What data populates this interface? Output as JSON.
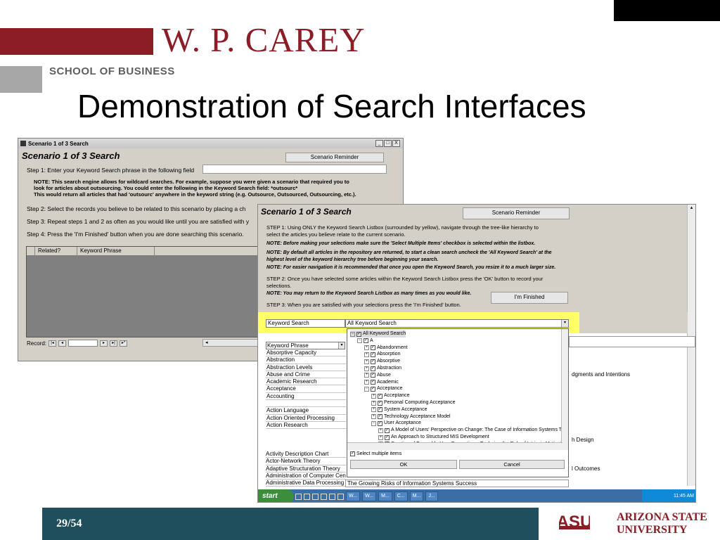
{
  "slide": {
    "brand_title": "W. P. CAREY",
    "school": "SCHOOL OF BUSINESS",
    "title": "Demonstration of Search Interfaces",
    "page": "29/54",
    "logo_text": "ASU",
    "university_line1": "ARIZONA STATE",
    "university_line2": "UNIVERSITY",
    "colors": {
      "brand_red": "#8c1d26",
      "footer": "#1f4f5c"
    }
  },
  "window1": {
    "titlebar": "Scenario 1 of 3 Search",
    "controls": [
      "_",
      "□",
      "X"
    ],
    "heading": "Scenario 1 of 3 Search",
    "reminder_button": "Scenario Reminder",
    "step1": "Step 1: Enter your Keyword Search phrase in the following field",
    "note_line1": "NOTE:  This search engine allows for wildcard searches.  For example, suppose you were given a scenario that required you to",
    "note_line2": "look for articles about outsourcing.   You could enter the following in the Keyword Search field:   *outsourc*",
    "note_line3": "This would return  all articles that had 'outsourc' anywhere in the keyword string (e.g. Outsource, Outsourced, Outsourcing, etc.).",
    "step2": "Step 2: Select the records you believe to be related to this scenario by placing a ch",
    "step3": "Step 3: Repeat steps 1 and 2 as often as you would like until you are satisfied with y",
    "step4": "Step 4: Press the 'I'm Finished' button when you are done searching this scenario.",
    "grid_headers": [
      "Related?",
      "Keyword Phrase"
    ],
    "record_label": "Record:",
    "nav_icons": [
      "first-record-icon",
      "prev-record-icon",
      "next-record-icon",
      "last-record-icon",
      "new-record-icon"
    ]
  },
  "window2": {
    "heading": "Scenario 1 of 3 Search",
    "reminder_button": "Scenario Reminder",
    "finished_button": "I'm Finished",
    "step1_line1": "STEP 1:  Using ONLY the Keyword Search Listbox (surrounded by yellow), navigate through the tree-like hierarchy to",
    "step1_line2": "select the articles you believe relate to the current scenario.",
    "note1": "NOTE: Before making your selections make sure the 'Select Multiple Items' checkbox is selected within the listbox.",
    "note2_line1": "NOTE: By default all articles in the repository are returned, to start a clean search uncheck the 'All Keyword Search' at the",
    "note2_line2": "highest level of the keyword hierarchy tree before beginning your search.",
    "note3": "NOTE: For easier navigation it is recommended that once you open the Keyword Search, you resize it to a much larger size.",
    "step2_line1": "STEP 2:  Once you have selected some articles within the Keyword Search Listbox press the 'OK' button to record your",
    "step2_line2": "selections.",
    "note4": "NOTE: You may return to the Keyword Search Listbox as many times as you would like.",
    "step3": "STEP 3:  When you are satisfied with your selections press the 'I'm Finished' button.",
    "keyword_label": "Keyword Search",
    "keyword_value": "All Keyword Search",
    "phrase_header": "Keyword Phrase",
    "phrases_top": [
      "Absorptive Capacity",
      "Abstraction",
      "Abstraction Levels",
      "Abuse and Crime",
      "Academic Research",
      "Acceptance",
      "Accounting",
      "",
      "Action Language",
      "Action Oriented Processing",
      "Action Research"
    ],
    "phrases_bottom": [
      "Activity Description Chart",
      "Actor-Network Theory",
      "Adaptive Structuration Theory",
      "Administration of Computer Cen",
      "Administrative Data Processing"
    ],
    "bottom_title": "The Growing Risks of Information Systems Success",
    "side_text_1": "dgments and Intentions",
    "side_text_2": "h Design",
    "side_text_3": "l Outcomes"
  },
  "tree": {
    "items": [
      {
        "label": "All Keyword Search",
        "level": 0,
        "pm": "−"
      },
      {
        "label": "A",
        "level": 1,
        "pm": "−"
      },
      {
        "label": "Abandonment",
        "level": 2,
        "pm": "+"
      },
      {
        "label": "Absorption",
        "level": 2,
        "pm": "+"
      },
      {
        "label": "Absorptive",
        "level": 2,
        "pm": "+"
      },
      {
        "label": "Abstraction",
        "level": 2,
        "pm": "+"
      },
      {
        "label": "Abuse",
        "level": 2,
        "pm": "+"
      },
      {
        "label": "Academic",
        "level": 2,
        "pm": "+"
      },
      {
        "label": "Acceptance",
        "level": 2,
        "pm": "−"
      },
      {
        "label": "Acceptance",
        "level": 3,
        "pm": "+"
      },
      {
        "label": "Personal Computing Acceptance",
        "level": 3,
        "pm": "+"
      },
      {
        "label": "System Acceptance",
        "level": 3,
        "pm": "+"
      },
      {
        "label": "Technology Acceptance Model",
        "level": 3,
        "pm": "+"
      },
      {
        "label": "User Acceptance",
        "level": 3,
        "pm": "−"
      },
      {
        "label": "A Model of Users' Perspective on Change: The Case of Information Systems Te",
        "level": 4,
        "pm": "+"
      },
      {
        "label": "An Approach to Structured MIS Development",
        "level": 4,
        "pm": "+"
      },
      {
        "label": "Creation of Favorable User Perceptions: Exploring the Role of Intrinsic Motivati",
        "level": 4,
        "pm": "+"
      }
    ],
    "select_multiple": "Select multiple items",
    "ok_button": "OK",
    "cancel_button": "Cancel"
  },
  "taskbar": {
    "start": "start",
    "tasks": [
      "W...",
      "W...",
      "M...",
      "C...",
      "M...",
      "J..."
    ],
    "clock": "11:45 AM"
  }
}
